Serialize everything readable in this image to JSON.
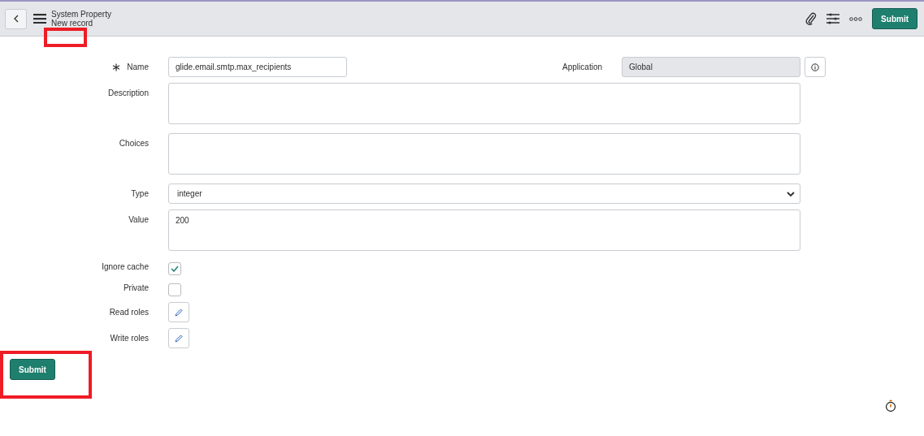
{
  "header": {
    "title": "System Property",
    "subtitle": "New record",
    "submit": "Submit"
  },
  "fields": [
    {
      "kind": "text",
      "label": "Name",
      "required": true,
      "value": "glide.email.smtp.max_recipients",
      "side": {
        "label": "Application",
        "value": "Global"
      }
    },
    {
      "kind": "textarea",
      "label": "Description"
    },
    {
      "kind": "textarea",
      "label": "Choices"
    },
    {
      "kind": "select",
      "label": "Type",
      "value": "integer"
    },
    {
      "kind": "textarea",
      "label": "Value",
      "value": "200"
    },
    {
      "kind": "checkbox",
      "label": "Ignore cache",
      "checked": true
    },
    {
      "kind": "checkbox",
      "label": "Private",
      "checked": false
    },
    {
      "kind": "roles",
      "label": "Read roles"
    },
    {
      "kind": "roles",
      "label": "Write roles"
    }
  ],
  "submit": "Submit",
  "annotations": [
    {
      "kind": "highlight"
    },
    {
      "kind": "highlight"
    }
  ]
}
